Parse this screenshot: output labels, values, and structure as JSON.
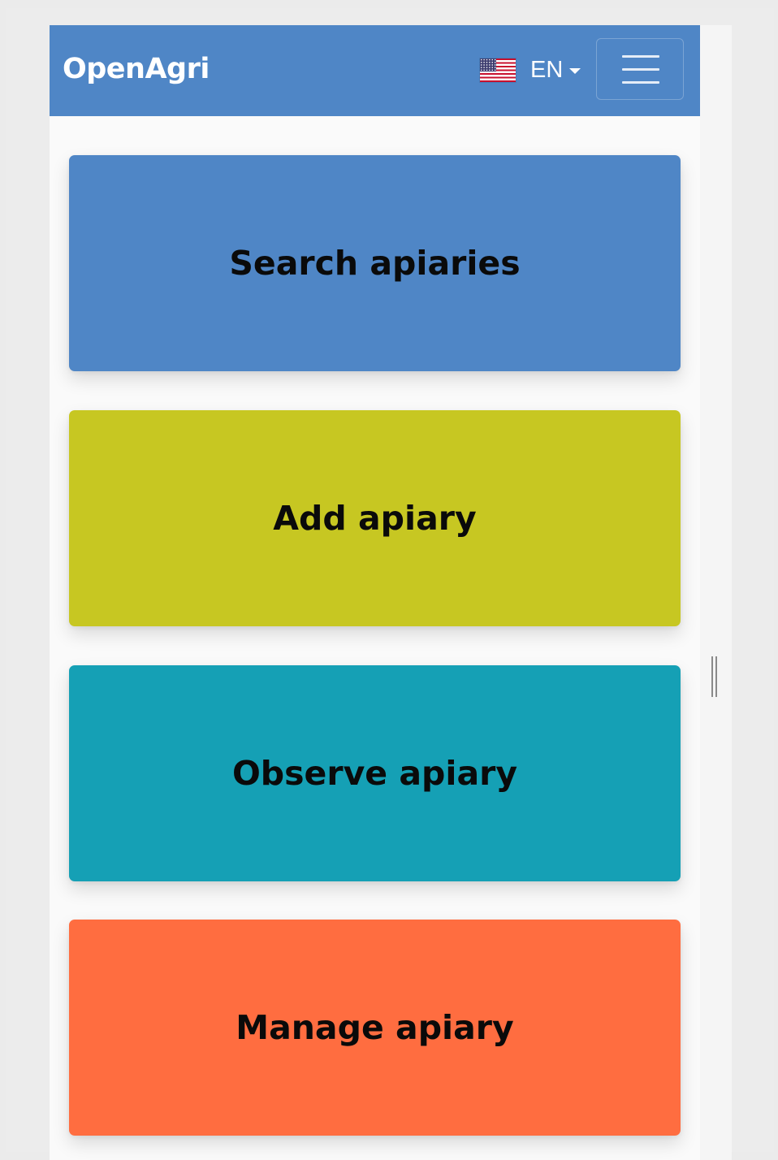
{
  "navbar": {
    "brand": "OpenAgri",
    "background": "#4f86c6",
    "language": {
      "label": "EN",
      "flag_icon": "us-flag-icon",
      "caret_icon": "caret-down-icon"
    },
    "menu_icon": "hamburger-menu-icon"
  },
  "tiles": [
    {
      "label": "Search apiaries",
      "color": "#4f86c6"
    },
    {
      "label": "Add apiary",
      "color": "#c7c722"
    },
    {
      "label": "Observe apiary",
      "color": "#15a0b5"
    },
    {
      "label": "Manage apiary",
      "color": "#ff6d40"
    }
  ]
}
